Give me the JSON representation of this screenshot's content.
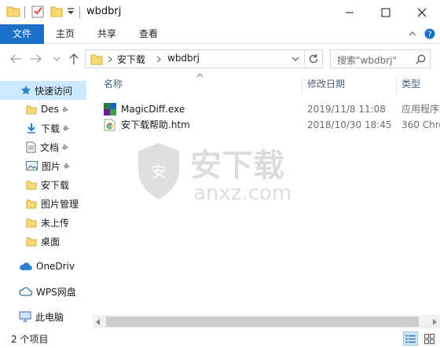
{
  "window": {
    "title": "wbdbrj",
    "controls": [
      "minimize-icon",
      "maximize-icon",
      "close-icon"
    ]
  },
  "ribbon": {
    "tabs": [
      "文件",
      "主页",
      "共享",
      "查看"
    ],
    "active_tab": "文件"
  },
  "address": {
    "breadcrumb": [
      "安下载",
      "wbdbrj"
    ],
    "search_placeholder": "搜索\"wbdbrj\""
  },
  "nav_pane": {
    "items": [
      {
        "label": "快速访问",
        "icon": "star-icon",
        "selected": true
      },
      {
        "label": "Des",
        "icon": "folder-icon",
        "pinned": true
      },
      {
        "label": "下载",
        "icon": "download-icon",
        "pinned": true
      },
      {
        "label": "文档",
        "icon": "document-icon",
        "pinned": true
      },
      {
        "label": "图片",
        "icon": "picture-icon",
        "pinned": true
      },
      {
        "label": "安下载",
        "icon": "folder-icon"
      },
      {
        "label": "图片管理",
        "icon": "folder-icon"
      },
      {
        "label": "未上传",
        "icon": "folder-icon"
      },
      {
        "label": "桌面",
        "icon": "folder-icon"
      },
      {
        "label": "OneDriv",
        "icon": "cloud-icon"
      },
      {
        "label": "WPS网盘",
        "icon": "cloud-outline-icon"
      },
      {
        "label": "此电脑",
        "icon": "computer-icon"
      }
    ]
  },
  "file_list": {
    "columns": [
      "名称",
      "修改日期",
      "类型"
    ],
    "rows": [
      {
        "name": "MagicDiff.exe",
        "modified": "2019/11/8 11:08",
        "type": "应用程序",
        "icon": "exe-icon"
      },
      {
        "name": "安下载帮助.htm",
        "modified": "2018/10/30 18:45",
        "type": "360 Chro",
        "icon": "html-file-icon"
      }
    ]
  },
  "watermark": {
    "main_text": "安下载",
    "sub_text": "anxz.com"
  },
  "status_bar": {
    "item_count": "2 个项目"
  },
  "colors": {
    "accent": "#1a6fc8",
    "selected_bg": "#cce8ff",
    "folder": "#f8d775"
  }
}
